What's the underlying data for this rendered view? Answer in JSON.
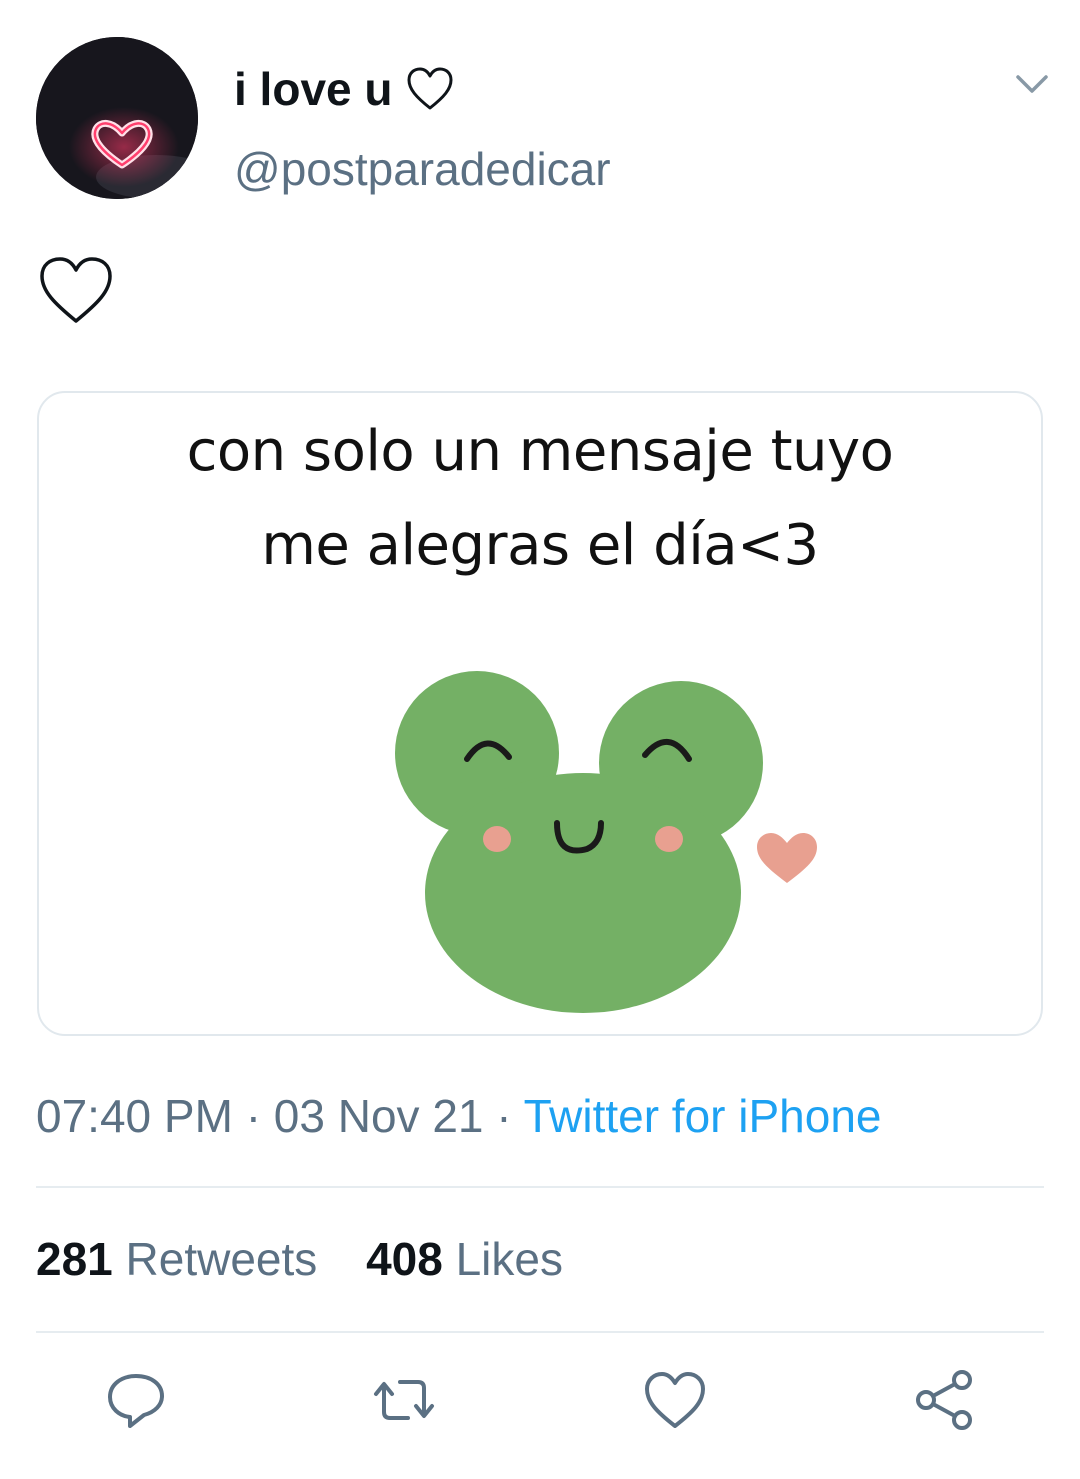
{
  "tweet": {
    "author": {
      "display_name": "i love u",
      "name_suffix_icon": "heart-outline-icon",
      "handle": "@postparadedicar",
      "avatar_icon": "neon-heart-avatar"
    },
    "menu_icon": "chevron-down-icon",
    "text_icon": "heart-outline-icon",
    "media": {
      "caption_line_1": "con solo un mensaje tuyo",
      "caption_line_2": "me alegras el día<3",
      "illustration": "frog-face-with-heart"
    },
    "time": "07:40 PM",
    "date": "03 Nov 21",
    "separator": "·",
    "source": "Twitter for iPhone",
    "retweets_count": "281",
    "retweets_label": "Retweets",
    "likes_count": "408",
    "likes_label": "Likes"
  },
  "actions": [
    {
      "icon": "reply-icon"
    },
    {
      "icon": "retweet-icon"
    },
    {
      "icon": "like-icon"
    },
    {
      "icon": "share-icon"
    }
  ],
  "colors": {
    "text_primary": "#0f1419",
    "text_secondary": "#5b7083",
    "link": "#1da1f2",
    "frog_green": "#74b065",
    "blush": "#e8a090"
  }
}
